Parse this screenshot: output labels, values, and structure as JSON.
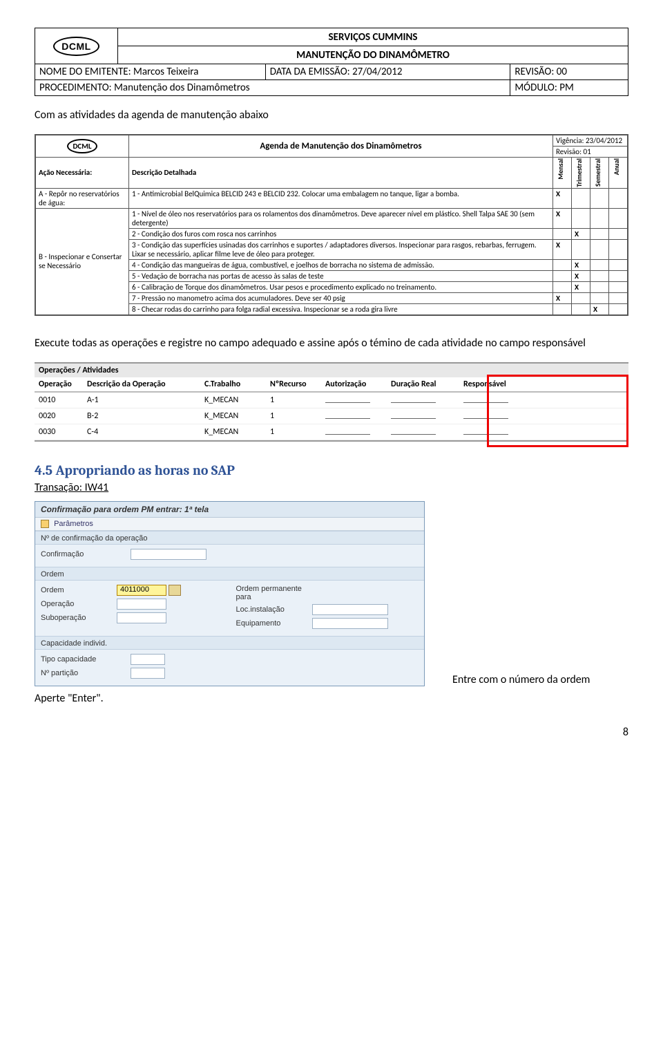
{
  "doc_header": {
    "logo": "DCML",
    "title1": "SERVIÇOS CUMMINS",
    "title2": "MANUTENÇÃO DO DINAMÔMETRO",
    "emitente_label": "NOME DO EMITENTE:",
    "emitente_value": "Marcos Teixeira",
    "data_label": "DATA DA EMISSÃO:",
    "data_value": "27/04/2012",
    "revisao_label": "REVISÃO:",
    "revisao_value": "00",
    "proc_label": "PROCEDIMENTO:",
    "proc_value": "Manutenção dos Dinamômetros",
    "modulo_label": "MÓDULO:",
    "modulo_value": "PM"
  },
  "para1": "Com as atividades da agenda de manutenção abaixo",
  "agenda": {
    "logo": "DCML",
    "title": "Agenda de Manutenção dos Dinamômetros",
    "vigencia": "Vigência: 23/04/2012",
    "revisao": "Revisão: 01",
    "col_acao": "Ação Necessária:",
    "col_desc": "Descrição Detalhada",
    "periods": [
      "Mensal",
      "Trimestral",
      "Semestral",
      "Anual"
    ],
    "group_a": "A - Repôr no reservatórios de água:",
    "group_b": "B - Inspecionar e Consertar se Necessário",
    "rows": [
      {
        "desc": "1 - Antimicrobial BelQuimica BELCID 243 e BELCID 232. Colocar uma embalagem no tanque, ligar a bomba.",
        "marks": [
          "X",
          "",
          "",
          ""
        ]
      },
      {
        "desc": "1 - Nível de óleo nos reservatórios para os rolamentos dos dinamômetros. Deve aparecer nível em plástico. Shell Talpa SAE 30 (sem detergente)",
        "marks": [
          "X",
          "",
          "",
          ""
        ]
      },
      {
        "desc": "2 - Condição dos furos com rosca nos carrinhos",
        "marks": [
          "",
          "X",
          "",
          ""
        ]
      },
      {
        "desc": "3 - Condição das superfícies usinadas dos carrinhos e suportes / adaptadores diversos. Inspecionar para rasgos, rebarbas, ferrugem. Lixar se necessário, aplicar filme leve de óleo para proteger.",
        "marks": [
          "X",
          "",
          "",
          ""
        ]
      },
      {
        "desc": "4 - Condição das mangueiras de água, combustível, e joelhos de borracha no sistema de admissão.",
        "marks": [
          "",
          "X",
          "",
          ""
        ]
      },
      {
        "desc": "5 - Vedação de borracha nas portas de acesso às salas de teste",
        "marks": [
          "",
          "X",
          "",
          ""
        ]
      },
      {
        "desc": "6 - Calibração de Torque dos dinamômetros. Usar pesos e procedimento explicado no treinamento.",
        "marks": [
          "",
          "X",
          "",
          ""
        ]
      },
      {
        "desc": "7 - Pressão no manometro acima dos acumuladores. Deve ser 40 psig",
        "marks": [
          "X",
          "",
          "",
          ""
        ]
      },
      {
        "desc": "8 - Checar rodas do carrinho para folga radial excessiva. Inspecionar se a roda gira livre",
        "marks": [
          "",
          "",
          "X",
          ""
        ]
      }
    ]
  },
  "para2": "Execute todas as operações e registre no campo adequado e assine após o témino de cada atividade no campo responsável",
  "ops": {
    "section_title": "Operações / Atividades",
    "headers": [
      "Operação",
      "Descrição da Operação",
      "C.Trabalho",
      "NºRecurso",
      "Autorização",
      "Duração Real",
      "Responsável"
    ],
    "rows": [
      {
        "op": "0010",
        "desc": "A-1",
        "ct": "K_MECAN",
        "nr": "1"
      },
      {
        "op": "0020",
        "desc": "B-2",
        "ct": "K_MECAN",
        "nr": "1"
      },
      {
        "op": "0030",
        "desc": "C-4",
        "ct": "K_MECAN",
        "nr": "1"
      }
    ]
  },
  "section45": {
    "title": "4.5 Apropriando as horas no SAP",
    "trans_label": "Transação: IW41"
  },
  "sap": {
    "window_title": "Confirmação para ordem PM entrar: 1ª tela",
    "toolbar": "Parâmetros",
    "grp1": "Nº de confirmação da operação",
    "l_confirm": "Confirmação",
    "grp2": "Ordem",
    "l_ordem": "Ordem",
    "v_ordem": "4011000",
    "l_oper": "Operação",
    "l_subop": "Suboperação",
    "l_ordperm": "Ordem permanente para",
    "l_loc": "Loc.instalação",
    "l_equip": "Equipamento",
    "grp3": "Capacidade individ.",
    "l_tipo": "Tipo capacidade",
    "l_npart": "Nº partição"
  },
  "rightnote": "Entre com o número da ordem",
  "para3": "Aperte \"Enter\".",
  "page_number": "8"
}
